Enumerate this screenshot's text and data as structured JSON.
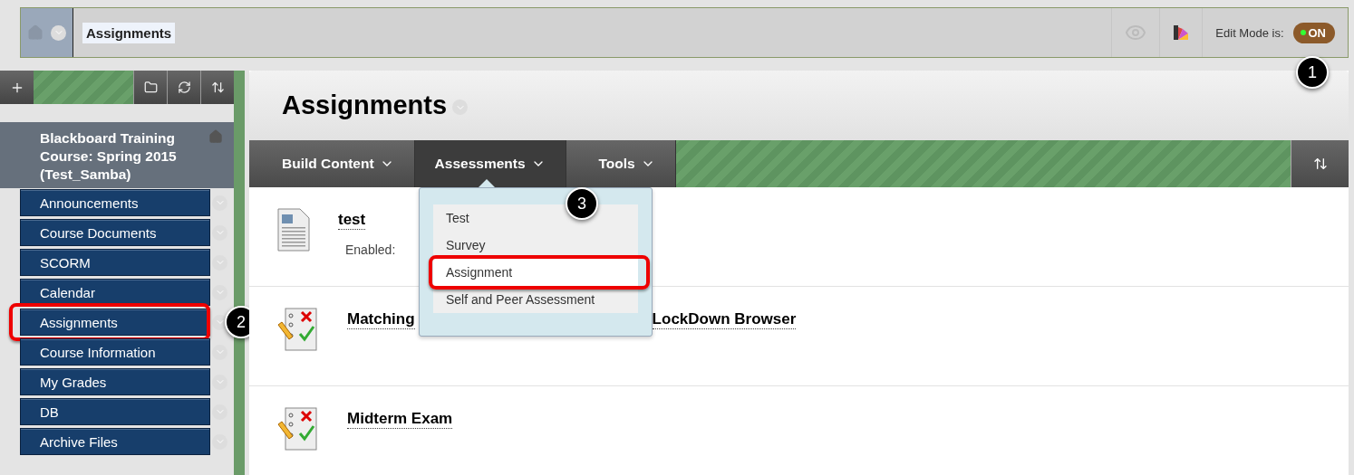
{
  "top_bar": {
    "breadcrumb": "Assignments",
    "edit_mode_label": "Edit Mode is:",
    "edit_mode": {
      "on": true,
      "label": "ON"
    }
  },
  "course": {
    "title": "Blackboard Training Course: Spring 2015 (Test_Samba)"
  },
  "menu_items": [
    {
      "label": "Announcements",
      "highlighted": false
    },
    {
      "label": "Course Documents",
      "highlighted": false
    },
    {
      "label": "SCORM",
      "highlighted": false
    },
    {
      "label": "Calendar",
      "highlighted": false
    },
    {
      "label": "Assignments",
      "highlighted": true
    },
    {
      "label": "Course Information",
      "highlighted": false
    },
    {
      "label": "My Grades",
      "highlighted": false
    },
    {
      "label": "DB",
      "highlighted": false
    },
    {
      "label": "Archive Files",
      "highlighted": false
    }
  ],
  "page_title": "Assignments",
  "action_bar": [
    {
      "label": "Build Content",
      "selected": false
    },
    {
      "label": "Assessments",
      "selected": true
    },
    {
      "label": "Tools",
      "selected": false
    }
  ],
  "dropdown": [
    {
      "label": "Test",
      "highlighted": false
    },
    {
      "label": "Survey",
      "highlighted": false
    },
    {
      "label": "Assignment",
      "highlighted": true
    },
    {
      "label": "Self and Peer Assessment",
      "highlighted": false
    }
  ],
  "content_items": [
    {
      "kind": "document",
      "title": "test",
      "detail": "Enabled:"
    },
    {
      "kind": "test",
      "title": "Matching",
      "title_end": "LockDown Browser"
    },
    {
      "kind": "test",
      "title": "Midterm Exam"
    }
  ],
  "callouts": [
    "1",
    "2",
    "3"
  ]
}
